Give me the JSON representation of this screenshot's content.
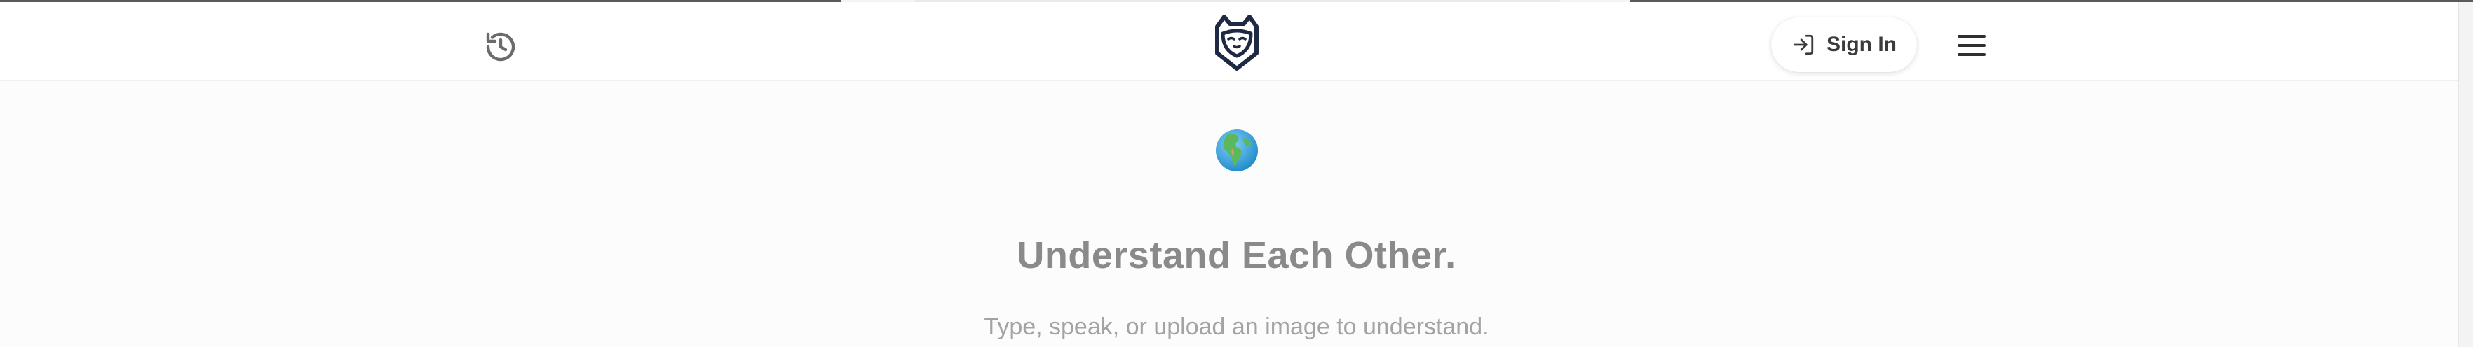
{
  "header": {
    "signin_label": "Sign In"
  },
  "icons": {
    "history": "history-icon",
    "logo": "cat-shield-logo",
    "signin": "sign-in-icon",
    "menu": "hamburger-menu-icon",
    "globe": "globe-emoji"
  },
  "main": {
    "headline": "Understand Each Other.",
    "subline": "Type, speak, or upload an image to understand."
  },
  "colors": {
    "background": "#fcfcfc",
    "logo": "#1e2a44",
    "headline": "#8a8a8a",
    "subline": "#a3a3a3"
  }
}
